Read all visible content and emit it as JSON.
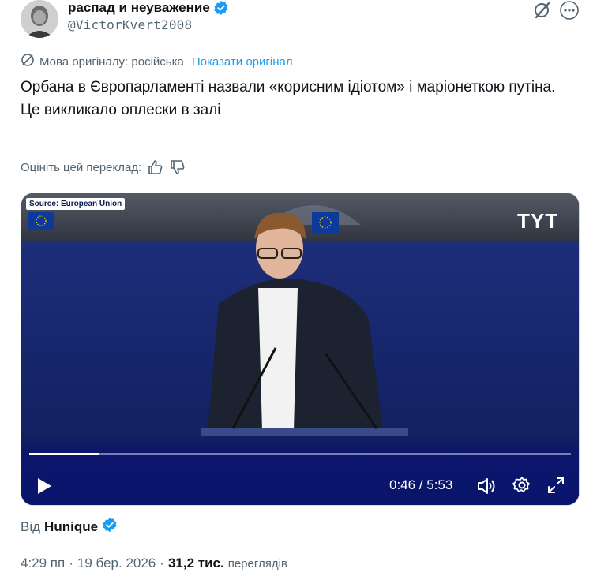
{
  "author": {
    "display_name": "распад и неуважение",
    "handle": "@VictorKvert2008",
    "verified_color": "#1d9bf0"
  },
  "translation": {
    "original_language": "Мова оригіналу: російська",
    "show_original": "Показати оригінал"
  },
  "tweet": {
    "line1": "Орбана в Європарламенті назвали «корисним ідіотом» і маріонеткою путіна.",
    "line2": "Це викликало оплески в залі"
  },
  "rating": {
    "label": "Оцініть цей переклад:"
  },
  "video": {
    "source_tag": "Source: European Union",
    "logo_text": "TYT",
    "current_time": "0:46",
    "duration": "5:53",
    "time_display": "0:46 / 5:53",
    "progress_fraction": 0.13
  },
  "attribution": {
    "prefix": "Від",
    "author": "Hunique"
  },
  "meta": {
    "time": "4:29 пп",
    "separator": "·",
    "date": "19 бер. 2026",
    "views_count": "31,2 тис.",
    "views_label": "переглядів"
  }
}
